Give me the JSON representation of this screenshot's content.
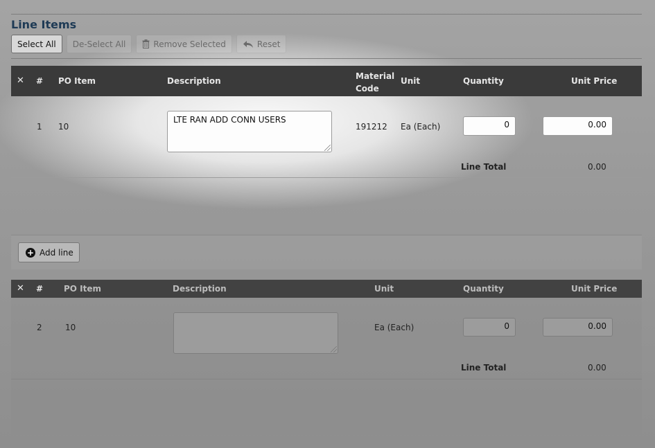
{
  "section": {
    "title": "Line Items"
  },
  "toolbar": {
    "select_all": "Select All",
    "deselect_all": "De-Select All",
    "remove_selected": "Remove Selected",
    "reset": "Reset"
  },
  "columns": {
    "remove": "✕",
    "number": "#",
    "po_item": "PO Item",
    "description": "Description",
    "material_code_line1": "Material",
    "material_code_line2": "Code",
    "unit": "Unit",
    "quantity": "Quantity",
    "unit_price": "Unit Price"
  },
  "items": [
    {
      "number": "1",
      "po_item": "10",
      "description": "LTE RAN ADD CONN USERS",
      "material_code": "191212",
      "unit": "Ea (Each)",
      "quantity": "0",
      "unit_price": "0.00",
      "line_total_label": "Line Total",
      "line_total": "0.00"
    },
    {
      "number": "2",
      "po_item": "10",
      "description": "",
      "unit": "Ea (Each)",
      "quantity": "0",
      "unit_price": "0.00",
      "line_total_label": "Line Total",
      "line_total": "0.00"
    }
  ],
  "add_line": {
    "label": "Add line"
  },
  "icons": {
    "trash": "trash-icon",
    "reset": "undo-arrow-icon",
    "add": "plus-circle-icon",
    "remove": "close-icon"
  },
  "colors": {
    "header_bg": "#3a3a3a",
    "title": "#1e3a55"
  }
}
